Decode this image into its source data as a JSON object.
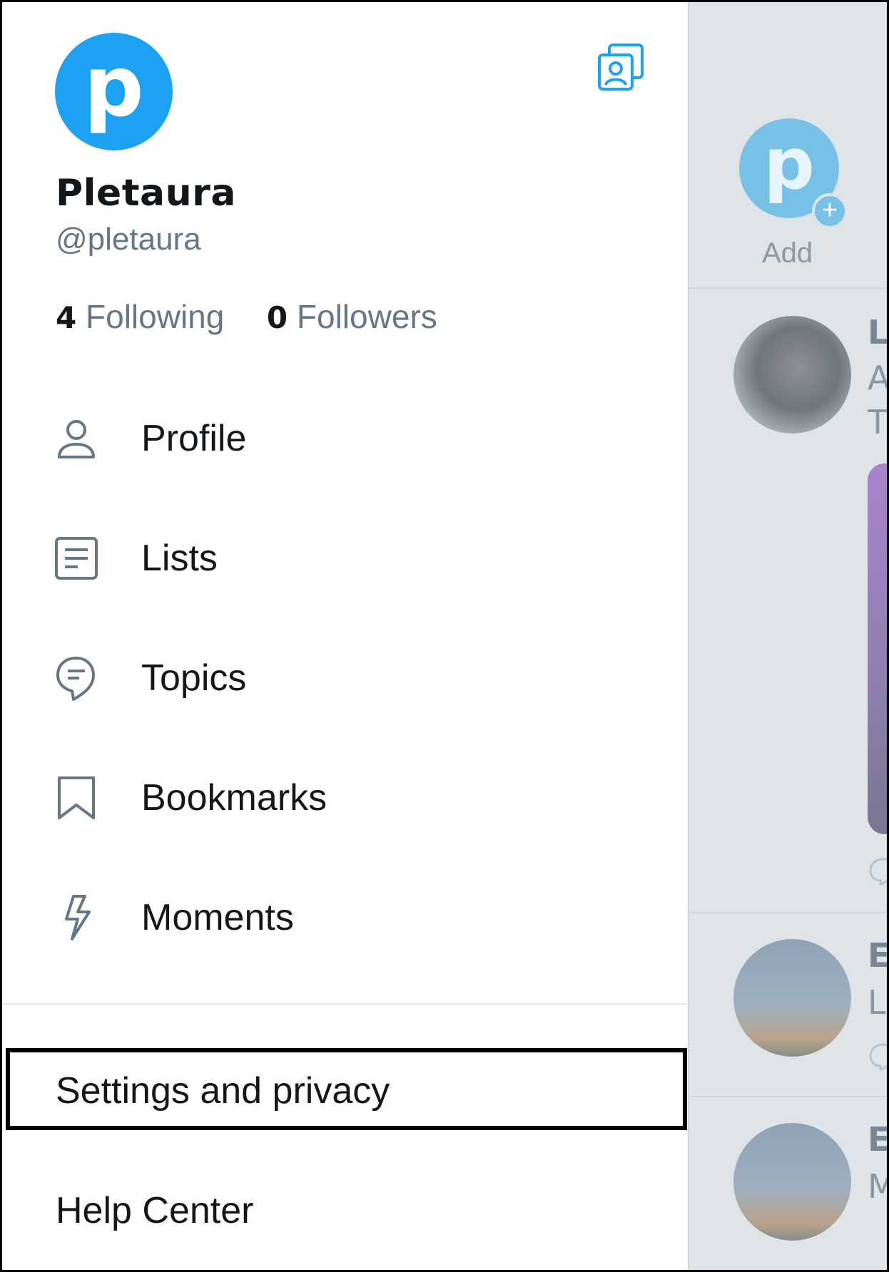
{
  "profile": {
    "avatar_letter": "p",
    "display_name": "Pletaura",
    "handle": "@pletaura",
    "following_count": "4",
    "following_label": "Following",
    "followers_count": "0",
    "followers_label": "Followers"
  },
  "menu": {
    "items": [
      {
        "label": "Profile",
        "icon": "person-icon"
      },
      {
        "label": "Lists",
        "icon": "lists-icon"
      },
      {
        "label": "Topics",
        "icon": "topics-icon"
      },
      {
        "label": "Bookmarks",
        "icon": "bookmark-icon"
      },
      {
        "label": "Moments",
        "icon": "lightning-icon"
      }
    ],
    "settings_label": "Settings and privacy",
    "help_label": "Help Center"
  },
  "timeline": {
    "add_avatar_letter": "p",
    "add_label": "Add",
    "tweet1_letters": [
      "L",
      "A",
      "T"
    ],
    "tweet2_letters": [
      "E",
      "L"
    ],
    "tweet3_letters": [
      "E",
      "M"
    ]
  },
  "colors": {
    "accent": "#1da1f2",
    "text_primary": "#14171a",
    "text_secondary": "#657786",
    "overlay": "#dfe4e8"
  }
}
